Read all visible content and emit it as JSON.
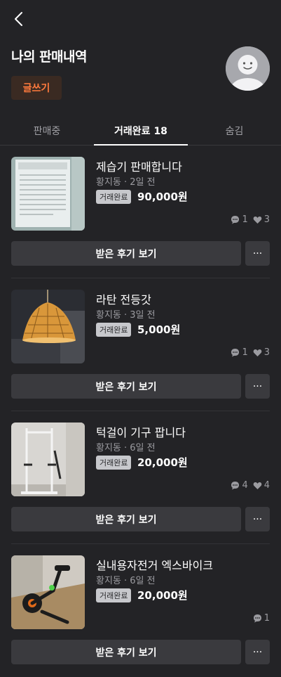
{
  "header": {
    "title": "나의 판매내역",
    "write_label": "글쓰기"
  },
  "tabs": [
    {
      "label": "판매중"
    },
    {
      "label": "거래완료 18"
    },
    {
      "label": "숨김"
    }
  ],
  "items": [
    {
      "title": "제습기 판매합니다",
      "meta": "황지동 · 2일 전",
      "badge": "거래완료",
      "price": "90,000원",
      "chats": "1",
      "likes": "3",
      "review": "받은 후기 보기",
      "more": "···"
    },
    {
      "title": "라탄 전등갓",
      "meta": "황지동 · 3일 전",
      "badge": "거래완료",
      "price": "5,000원",
      "chats": "1",
      "likes": "3",
      "review": "받은 후기 보기",
      "more": "···"
    },
    {
      "title": "턱걸이 기구 팝니다",
      "meta": "황지동 · 6일 전",
      "badge": "거래완료",
      "price": "20,000원",
      "chats": "4",
      "likes": "4",
      "review": "받은 후기 보기",
      "more": "···"
    },
    {
      "title": "실내용자전거 엑스바이크",
      "meta": "황지동 · 6일 전",
      "badge": "거래완료",
      "price": "20,000원",
      "chats": "1",
      "likes": "",
      "review": "받은 후기 보기",
      "more": "···"
    }
  ],
  "colors": {
    "background": "#232326",
    "accent": "#ff7a3d"
  }
}
